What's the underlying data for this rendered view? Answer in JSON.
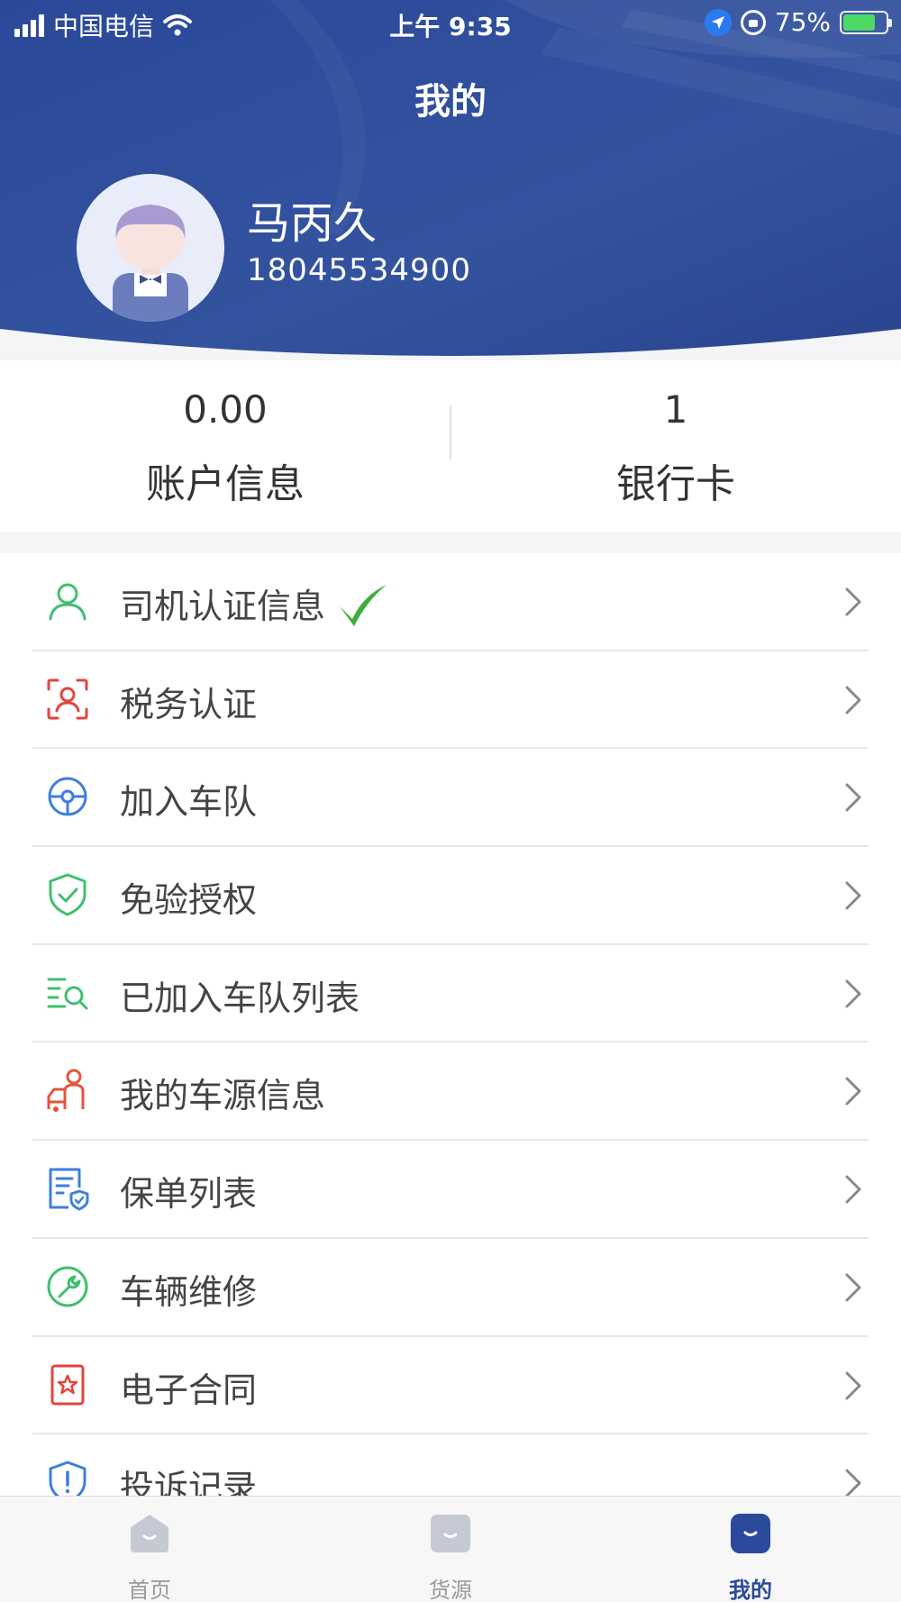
{
  "status_bar": {
    "carrier": "中国电信",
    "time": "上午 9:35",
    "battery": "75%"
  },
  "header": {
    "title": "我的"
  },
  "user": {
    "name": "马丙久",
    "phone": "18045534900"
  },
  "stats": [
    {
      "value": "0.00",
      "label": "账户信息"
    },
    {
      "value": "1",
      "label": "银行卡"
    }
  ],
  "menu": [
    {
      "label": "司机认证信息",
      "icon": "person-icon",
      "color": "#3fbf6e",
      "verified": true
    },
    {
      "label": "税务认证",
      "icon": "face-scan-icon",
      "color": "#e2453c"
    },
    {
      "label": "加入车队",
      "icon": "steering-wheel-icon",
      "color": "#3d7ee0"
    },
    {
      "label": "免验授权",
      "icon": "shield-check-icon",
      "color": "#3fbf6e"
    },
    {
      "label": "已加入车队列表",
      "icon": "list-search-icon",
      "color": "#3fbf6e"
    },
    {
      "label": "我的车源信息",
      "icon": "driver-icon",
      "color": "#e2563c"
    },
    {
      "label": "保单列表",
      "icon": "policy-icon",
      "color": "#3d7ee0"
    },
    {
      "label": "车辆维修",
      "icon": "wrench-icon",
      "color": "#3fbf6e"
    },
    {
      "label": "电子合同",
      "icon": "contract-icon",
      "color": "#e2453c"
    },
    {
      "label": "投诉记录",
      "icon": "complaint-shield-icon",
      "color": "#3d7ee0"
    }
  ],
  "tabs": [
    {
      "label": "首页",
      "active": false
    },
    {
      "label": "货源",
      "active": false
    },
    {
      "label": "我的",
      "active": true
    }
  ],
  "colors": {
    "header_blue": "#2f4fa3",
    "active_tab": "#2b4a9b",
    "inactive_tab": "#c5c9d3",
    "verified_check": "#3dae3c"
  }
}
